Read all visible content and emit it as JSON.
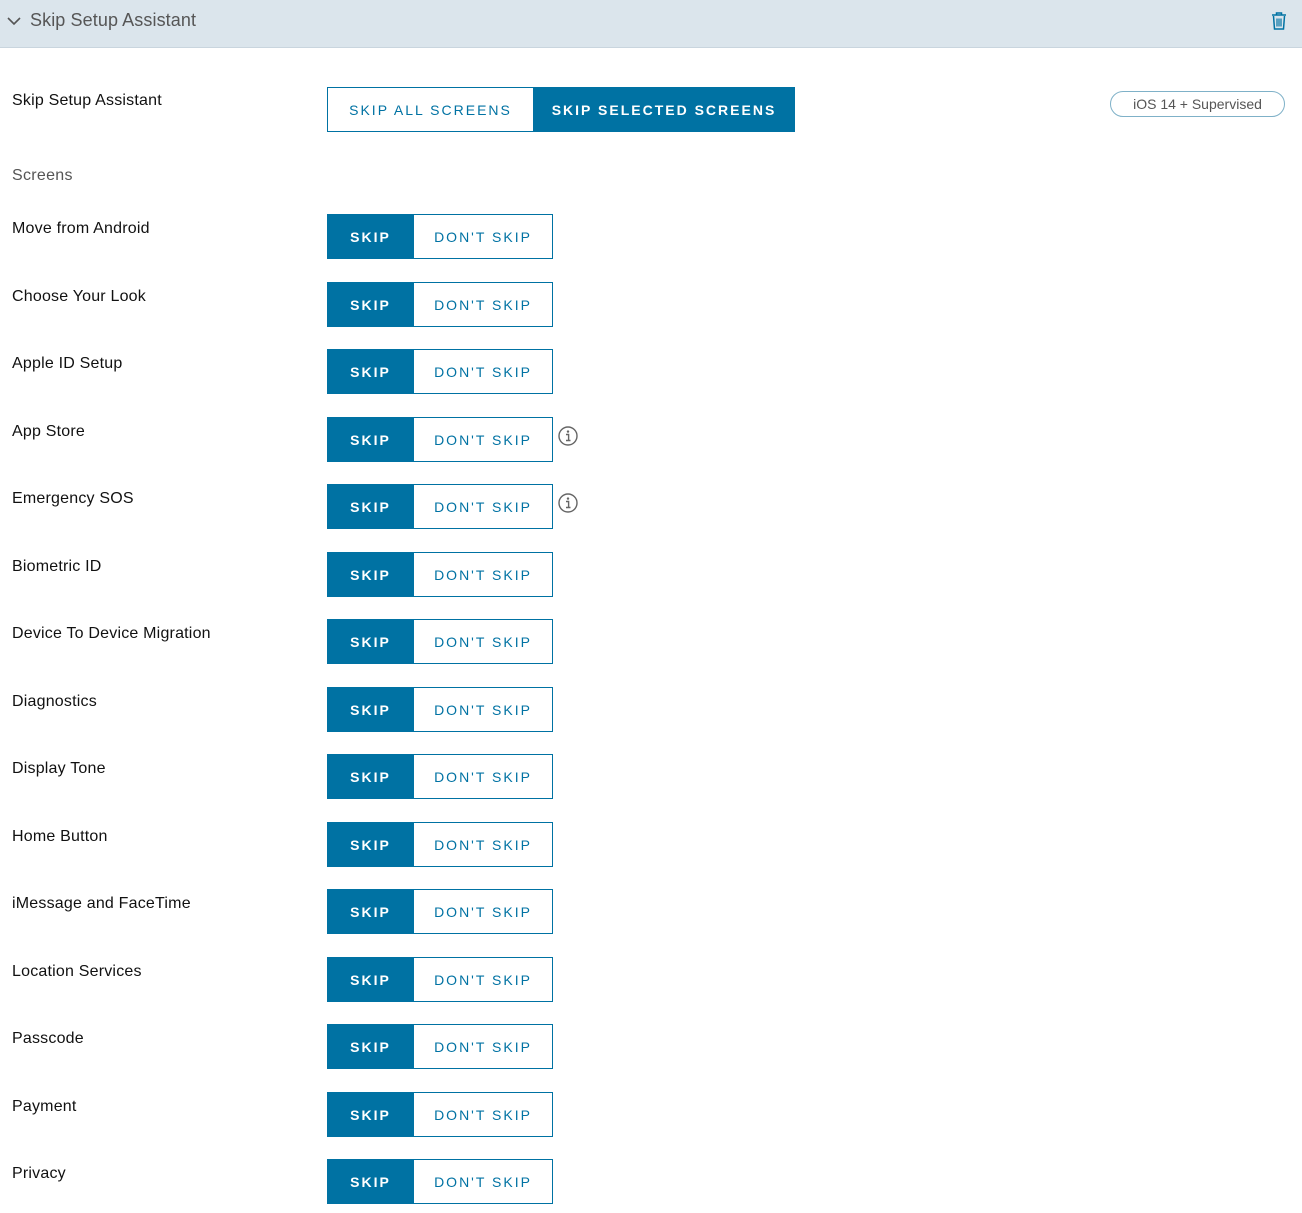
{
  "header": {
    "title": "Skip Setup Assistant",
    "collapse_icon": "chevron-down-icon",
    "delete_icon": "trash-icon"
  },
  "skip_setup": {
    "label": "Skip Setup Assistant",
    "options": [
      "SKIP ALL SCREENS",
      "SKIP SELECTED SCREENS"
    ],
    "selected": "SKIP SELECTED SCREENS",
    "badge": "iOS 14 + Supervised"
  },
  "screens_section": {
    "label": "Screens"
  },
  "toggle_labels": {
    "skip": "SKIP",
    "dont_skip": "DON'T SKIP"
  },
  "screens": [
    {
      "label": "Move from Android",
      "selected": "SKIP",
      "info": false
    },
    {
      "label": "Choose Your Look",
      "selected": "SKIP",
      "info": false
    },
    {
      "label": "Apple ID Setup",
      "selected": "SKIP",
      "info": false
    },
    {
      "label": "App Store",
      "selected": "SKIP",
      "info": true
    },
    {
      "label": "Emergency SOS",
      "selected": "SKIP",
      "info": true
    },
    {
      "label": "Biometric ID",
      "selected": "SKIP",
      "info": false
    },
    {
      "label": "Device To Device Migration",
      "selected": "SKIP",
      "info": false
    },
    {
      "label": "Diagnostics",
      "selected": "SKIP",
      "info": false
    },
    {
      "label": "Display Tone",
      "selected": "SKIP",
      "info": false
    },
    {
      "label": "Home Button",
      "selected": "SKIP",
      "info": false
    },
    {
      "label": "iMessage and FaceTime",
      "selected": "SKIP",
      "info": false
    },
    {
      "label": "Location Services",
      "selected": "SKIP",
      "info": false
    },
    {
      "label": "Passcode",
      "selected": "SKIP",
      "info": false
    },
    {
      "label": "Payment",
      "selected": "SKIP",
      "info": false
    },
    {
      "label": "Privacy",
      "selected": "SKIP",
      "info": false
    }
  ],
  "colors": {
    "accent": "#0072a3",
    "header_bg": "#dbe5ec"
  }
}
